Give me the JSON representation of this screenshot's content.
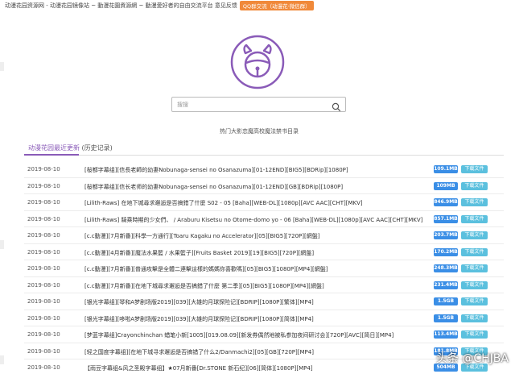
{
  "topbar": {
    "site_text": "动漫花园资源网 - 动漫花园镜像站 ~ 動漫花園資源網 ~ 動漫愛好者的自由交流平台 意见反馈",
    "qq_button": "QQ群交流（动漫花·微信群）"
  },
  "search": {
    "placeholder": "搜搜"
  },
  "hot_search": "热门大影恋魔高校魔法禁书目录",
  "section": {
    "title": "动漫花园最近更新",
    "history": "(历史记录)"
  },
  "rows": [
    {
      "date": "2019-08-10",
      "title": "[桜都字幕组][信長老師的幼妻Nobunaga-sensei no Osanazuma][01-12END][BIG5][BDRip][1080P]",
      "size": "109.1MB",
      "dl": "下载文件"
    },
    {
      "date": "2019-08-10",
      "title": "[桜都字幕组][信长老师的幼妻Nobunaga-sensei no Osanazuma][01-12END][GB][BDRip][1080P]",
      "size": "109MB",
      "dl": "下载文件"
    },
    {
      "date": "2019-08-10",
      "title": "[Lilith-Raws] 在地下城尋求邂逅是否搞錯了什麼 S02 - 05 [Baha][WEB-DL][1080p][AVC AAC][CHT][MKV]",
      "size": "846.9MB",
      "dl": "下载文件"
    },
    {
      "date": "2019-08-10",
      "title": "[Lilith-Raws] 騎乘時期的少女們、 / Araburu Kisetsu no Otome-domo yo - 06 [Baha][WEB-DL][1080p][AVC AAC][CHT][MKV]",
      "size": "857.1MB",
      "dl": "下载文件"
    },
    {
      "date": "2019-08-10",
      "title": "[c.c動漫][7月新番][科學一方通行][Toaru Kagaku no Accelerator][05][BIG5][720P][網盤]",
      "size": "203.7MB",
      "dl": "下载文件"
    },
    {
      "date": "2019-08-10",
      "title": "[c.c動漫][4月新番][魔法水果籃 / 水果籃子][Fruits Basket 2019][19][BIG5][720P][網盤]",
      "size": "170.2MB",
      "dl": "下载文件"
    },
    {
      "date": "2019-08-10",
      "title": "[c.c動漫][7月新番][普通攻擊是全體二連擊這樣的媽媽你喜歡嗎][05][BIG5][1080P][MP4][網盤]",
      "size": "248.3MB",
      "dl": "下载文件"
    },
    {
      "date": "2019-08-10",
      "title": "[c.c動漫][7月新番][在地下城尋求邂逅是否搞錯了什麼 第二季][05][BIG5][1080P][MP4][網盤]",
      "size": "231.4MB",
      "dl": "下载文件"
    },
    {
      "date": "2019-08-10",
      "title": "[银光字幕组][琴和A梦剧场版2019][039][大雄的月球探险记][BDRIP][1080P][繁体][MP4]",
      "size": "1.5GB",
      "dl": "下载文件"
    },
    {
      "date": "2019-08-10",
      "title": "[银光字幕组][哆啦A梦剧场版2019][039][大雄的月球探险记][BDRIP][1080P][简体][MP4]",
      "size": "1.5GB",
      "dl": "下载文件"
    },
    {
      "date": "2019-08-10",
      "title": "[梦蓝字幕组]Crayonchinchan 蜡笔小新[1005][019.08.09][新发券偶然地被私参加夜间研讨会][720P][AVC][简日][MP4]",
      "size": "113.4MB",
      "dl": "下载文件"
    },
    {
      "date": "2019-08-10",
      "title": "[轻之国度字幕组][在地下城寻求邂逅是否搞错了什么2/Danmachi2][05][GB][720P][MP4]",
      "size": "181.8MB",
      "dl": "下载文件"
    },
    {
      "date": "2019-08-10",
      "title": "【雨豆字幕组&风之圣殿字幕组】★07月新番[Dr.STONE 新石纪][06][简体][1080P][MP4]",
      "size": "504MB",
      "dl": "下载文件"
    }
  ],
  "watermark": "头条 @CHJBA",
  "colors": {
    "accent": "#8a5bb8",
    "size_badge": "#3a8ee6",
    "download_button": "#5bc0de",
    "qq_button": "#f0893a"
  }
}
